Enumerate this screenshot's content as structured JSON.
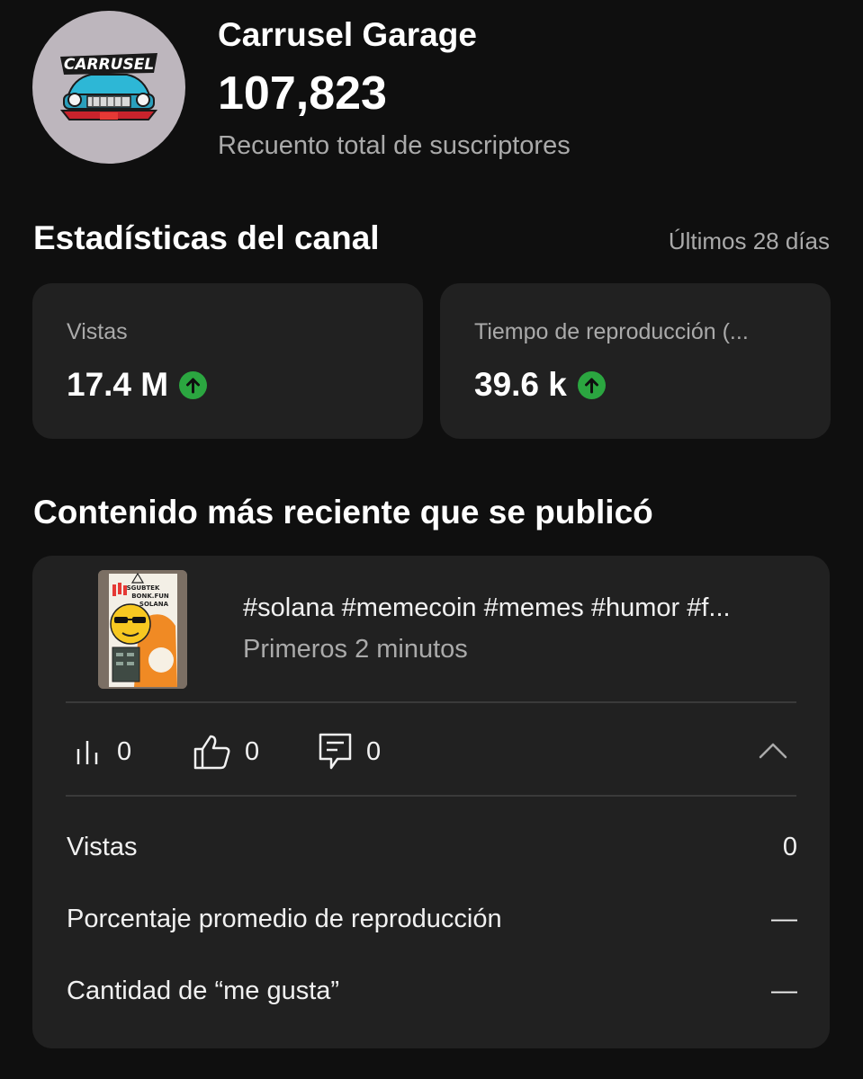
{
  "channel": {
    "name": "Carrusel Garage",
    "logo_text": "CARRUSEL",
    "subscriber_count": "107,823",
    "subscriber_label": "Recuento total de suscriptores"
  },
  "stats": {
    "title": "Estadísticas del canal",
    "period": "Últimos 28 días",
    "cards": [
      {
        "label": "Vistas",
        "value": "17.4 M",
        "trend": "up"
      },
      {
        "label": "Tiempo de reproducción (...",
        "value": "39.6 k",
        "trend": "up"
      }
    ]
  },
  "recent": {
    "title": "Contenido más reciente que se publicó",
    "thumbnail_text": [
      "SGUBTEK",
      "BONK.FUN",
      "SOLANA"
    ],
    "video_title": "#solana #memecoin #memes #humor #f...",
    "video_subtitle": "Primeros 2 minutos",
    "metrics": {
      "views": "0",
      "likes": "0",
      "comments": "0"
    },
    "rows": [
      {
        "label": "Vistas",
        "value": "0"
      },
      {
        "label": "Porcentaje promedio de reproducción",
        "value": "—"
      },
      {
        "label": "Cantidad de “me gusta”",
        "value": "—"
      }
    ]
  },
  "colors": {
    "background": "#0f0f0f",
    "card": "#212121",
    "trend_up": "#2ba640",
    "secondary_text": "#aaaaaa"
  }
}
